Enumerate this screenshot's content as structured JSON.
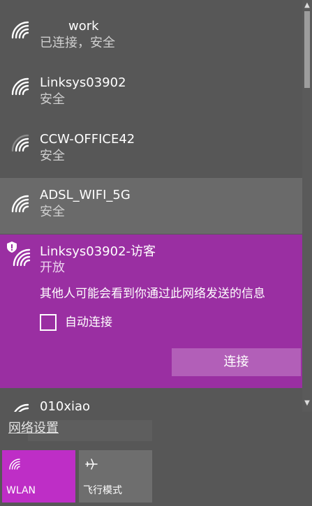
{
  "networks": [
    {
      "name": "work",
      "status": "已连接，安全"
    },
    {
      "name": "Linksys03902",
      "status": "安全"
    },
    {
      "name": "CCW-OFFICE42",
      "status": "安全"
    },
    {
      "name": "ADSL_WIFI_5G",
      "status": "安全"
    }
  ],
  "selected_network": {
    "name": "Linksys03902-访客",
    "status": "开放",
    "warning": "其他人可能会看到你通过此网络发送的信息",
    "auto_connect_label": "自动连接",
    "auto_connect_checked": false,
    "connect_label": "连接"
  },
  "partial_network": {
    "name": "010xiao"
  },
  "settings_link": "网络设置",
  "quick_actions": [
    {
      "label": "WLAN",
      "icon": "wifi-icon",
      "active": true
    },
    {
      "label": "飞行模式",
      "icon": "airplane-icon",
      "active": false
    }
  ],
  "colors": {
    "panel_bg": "#575757",
    "hover_bg": "#6a6a6a",
    "accent": "#9a2fa2",
    "wlan_tile": "#be2ec6",
    "connect_button": "#b25fb8"
  }
}
